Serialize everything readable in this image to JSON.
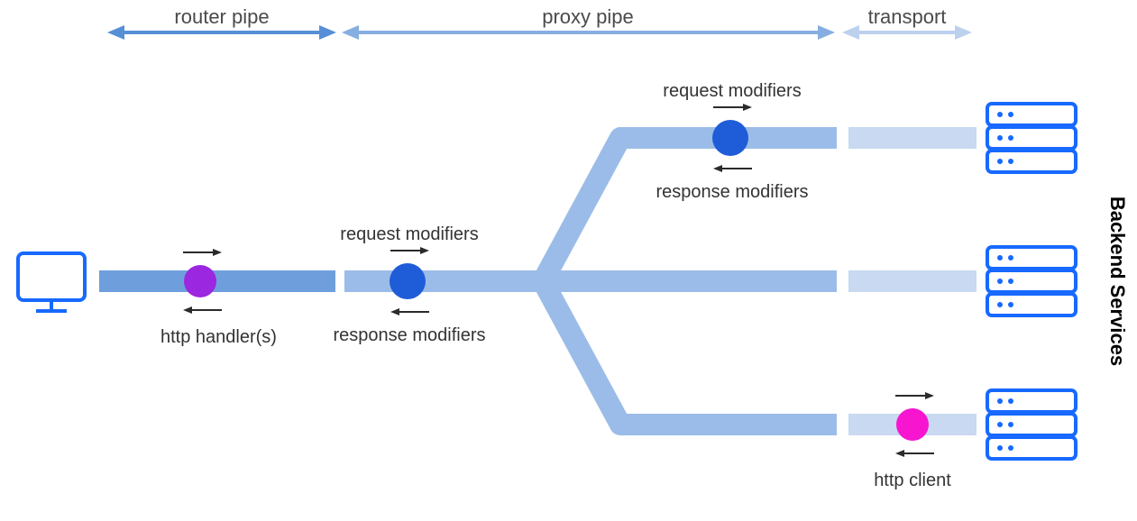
{
  "header": {
    "router_pipe": "router pipe",
    "proxy_pipe": "proxy pipe",
    "transport": "transport"
  },
  "nodes": {
    "http_handler": "http handler(s)",
    "request_modifiers": "request modifiers",
    "response_modifiers": "response modifiers",
    "http_client": "http client"
  },
  "side_label": "Backend Services",
  "colors": {
    "router_stroke": "#568fd6",
    "proxy_stroke": "#87aee1",
    "transport_stroke": "#bcd1ed",
    "pipe_router": "#6e9fdc",
    "pipe_proxy": "#9bbce8",
    "pipe_transport": "#c8d9f1",
    "dot_handler": "#9b27e0",
    "dot_modifier": "#1f5cd8",
    "dot_client": "#f815d0",
    "icon_blue": "#1769ff",
    "arrow_dark": "#2b2b2b"
  }
}
